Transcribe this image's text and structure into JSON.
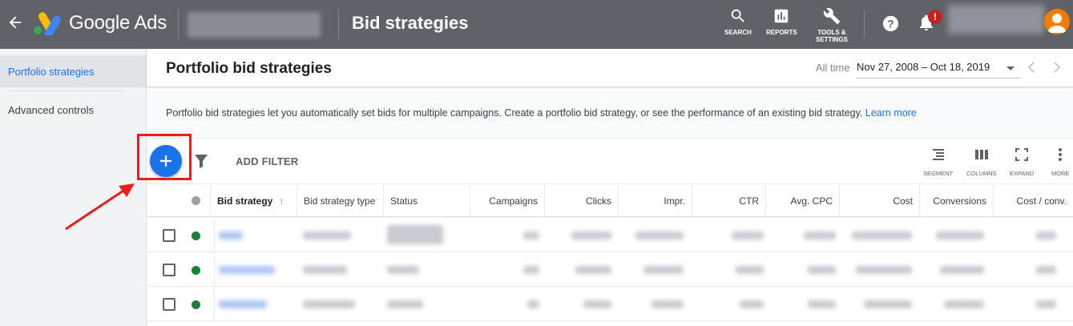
{
  "topbar": {
    "brand": "Google Ads",
    "page_title": "Bid strategies",
    "tools": [
      {
        "label": "SEARCH",
        "icon": "search-icon"
      },
      {
        "label": "REPORTS",
        "icon": "reports-icon"
      },
      {
        "label": "TOOLS &\nSETTINGS",
        "icon": "wrench-icon"
      }
    ],
    "notification_badge": "!"
  },
  "sidebar": {
    "items": [
      {
        "label": "Portfolio strategies",
        "active": true
      },
      {
        "label": "Advanced controls",
        "active": false
      }
    ]
  },
  "header": {
    "title": "Portfolio bid strategies",
    "date_label": "All time",
    "date_range": "Nov 27, 2008 – Oct 18, 2019"
  },
  "description": {
    "text": "Portfolio bid strategies let you automatically set bids for multiple campaigns. Create a portfolio bid strategy, or see the performance of an existing bid strategy. ",
    "link": "Learn more"
  },
  "toolbar": {
    "add_filter": "ADD FILTER",
    "tools": [
      {
        "label": "SEGMENT",
        "icon": "segment-icon"
      },
      {
        "label": "COLUMNS",
        "icon": "columns-icon"
      },
      {
        "label": "EXPAND",
        "icon": "expand-icon"
      },
      {
        "label": "MORE",
        "icon": "more-vert-icon"
      }
    ]
  },
  "table": {
    "columns": [
      "Bid strategy",
      "Bid strategy type",
      "Status",
      "Campaigns",
      "Clicks",
      "Impr.",
      "CTR",
      "Avg. CPC",
      "Cost",
      "Conversions",
      "Cost / conv."
    ]
  },
  "colors": {
    "topbar": "#5f6368",
    "accent": "#1a73e8",
    "highlight": "#ea1d1d",
    "status_enabled": "#188038"
  }
}
